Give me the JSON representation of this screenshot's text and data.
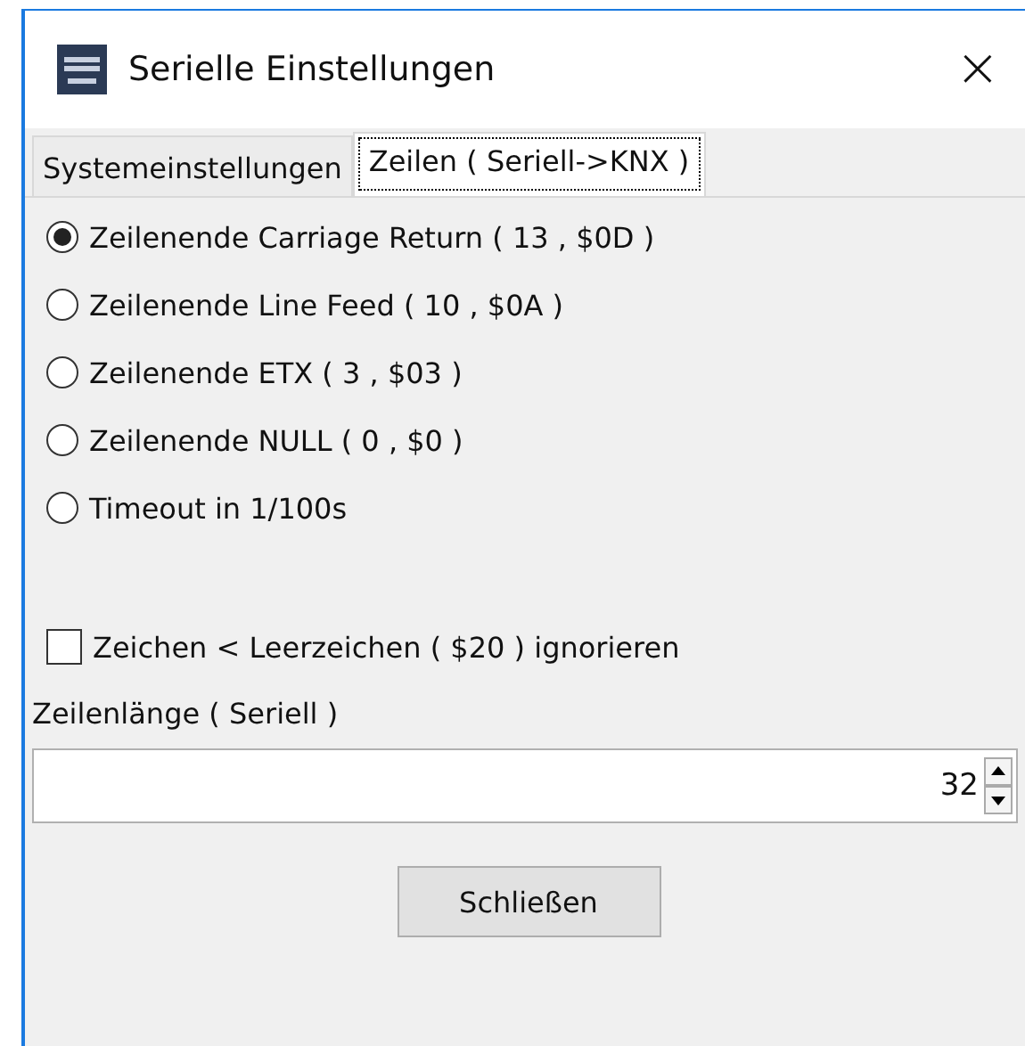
{
  "window": {
    "title": "Serielle Einstellungen",
    "close": "×"
  },
  "tabs": [
    {
      "label": "Systemeinstellungen",
      "selected": false
    },
    {
      "label": "Zeilen ( Seriell->KNX )",
      "selected": true
    }
  ],
  "options": [
    {
      "label": "Zeilenende Carriage Return ( 13 , $0D )",
      "selected": true
    },
    {
      "label": "Zeilenende Line Feed ( 10 , $0A )",
      "selected": false
    },
    {
      "label": "Zeilenende ETX ( 3 , $03 )",
      "selected": false
    },
    {
      "label": "Zeilenende NULL ( 0 , $0 )",
      "selected": false
    },
    {
      "label": "Timeout in 1/100s",
      "selected": false
    }
  ],
  "ignore_checkbox": {
    "label": "Zeichen < Leerzeichen ( $20 ) ignorieren",
    "checked": false
  },
  "line_length": {
    "label": "Zeilenlänge ( Seriell )",
    "value": "32"
  },
  "buttons": [
    "Schließen"
  ]
}
